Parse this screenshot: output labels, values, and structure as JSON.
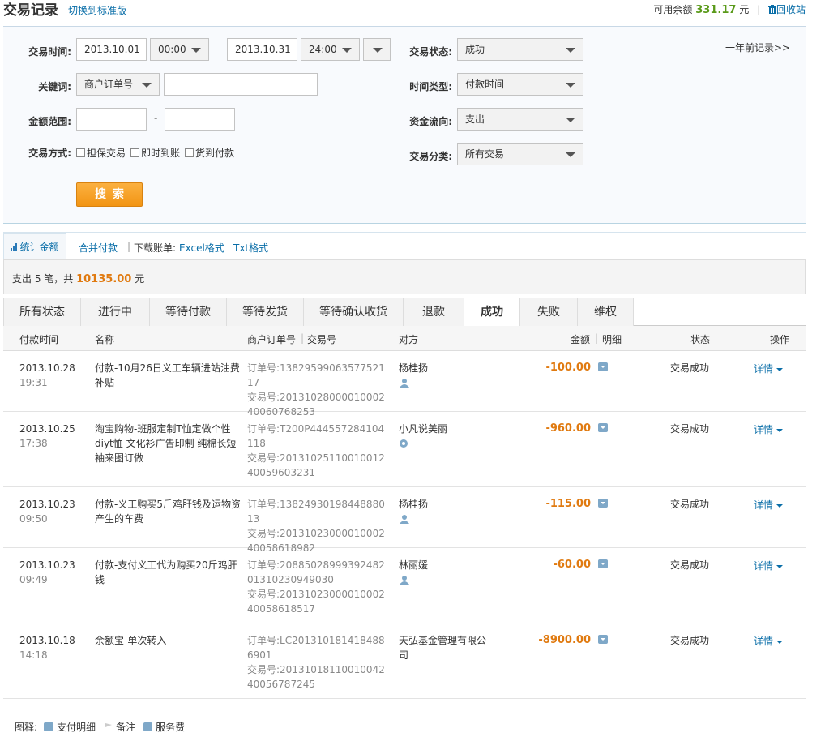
{
  "header": {
    "title": "交易记录",
    "switch_link": "切换到标准版",
    "balance_label": "可用余额",
    "balance_value": "331.17",
    "balance_unit": "元",
    "recycle_link": "回收站"
  },
  "filter": {
    "time_label": "交易时间:",
    "start_date": "2013.10.01",
    "start_time": "00:00",
    "range_dash": "-",
    "end_date": "2013.10.31",
    "end_time": "24:00",
    "keyword_label": "关键词:",
    "keyword_type": "商户订单号",
    "keyword_value": "",
    "amount_label": "金额范围:",
    "amount_min": "",
    "amount_max": "",
    "method_label": "交易方式:",
    "methods": [
      "担保交易",
      "即时到账",
      "货到付款"
    ],
    "status_label": "交易状态:",
    "status_value": "成功",
    "timetype_label": "时间类型:",
    "timetype_value": "付款时间",
    "flow_label": "资金流向:",
    "flow_value": "支出",
    "category_label": "交易分类:",
    "category_value": "所有交易",
    "search_button": "搜索",
    "history_link": "一年前记录>>"
  },
  "toolbar": {
    "stat": "统计金额",
    "merge": "合并付款",
    "separator": "|",
    "download_label": "下载账单:",
    "excel": "Excel格式",
    "txt": "Txt格式"
  },
  "summary": {
    "prefix": "支出 5 笔，共",
    "amount": "10135.00",
    "unit": "元"
  },
  "tabs": [
    "所有状态",
    "进行中",
    "等待付款",
    "等待发货",
    "等待确认收货",
    "退款",
    "成功",
    "失败",
    "维权"
  ],
  "active_tab": "成功",
  "columns": {
    "time": "付款时间",
    "name": "名称",
    "order": "商户订单号",
    "trade": "交易号",
    "party": "对方",
    "amount": "金额",
    "detail": "明细",
    "status": "状态",
    "op": "操作"
  },
  "rows": [
    {
      "date": "2013.10.28",
      "time": "19:31",
      "name": "付款-10月26日义工车辆进站油费补贴",
      "order": "订单号:1382959906357752117",
      "trade": "交易号:2013102800001000240060768253",
      "party": "杨桂扬",
      "amount": "-100.00",
      "status": "交易成功",
      "op": "详情"
    },
    {
      "date": "2013.10.25",
      "time": "17:38",
      "name": "淘宝购物-班服定制T恤定做个性diyt恤 文化衫广告印制 纯棉长短袖来图订做",
      "order": "订单号:T200P444557284104118",
      "trade": "交易号:2013102511001001240059603231",
      "party": "小凡说美丽",
      "amount": "-960.00",
      "status": "交易成功",
      "op": "详情"
    },
    {
      "date": "2013.10.23",
      "time": "09:50",
      "name": "付款-义工购买5斤鸡肝钱及运物资产生的车费",
      "order": "订单号:1382493019844888013",
      "trade": "交易号:2013102300001000240058618982",
      "party": "杨桂扬",
      "amount": "-115.00",
      "status": "交易成功",
      "op": "详情"
    },
    {
      "date": "2013.10.23",
      "time": "09:49",
      "name": "付款-支付义工代为购买20斤鸡肝钱",
      "order": "订单号:2088502899939248201310230949030",
      "trade": "交易号:2013102300001000240058618517",
      "party": "林丽媛",
      "amount": "-60.00",
      "status": "交易成功",
      "op": "详情"
    },
    {
      "date": "2013.10.18",
      "time": "14:18",
      "name": "余额宝-单次转入",
      "order": "订单号:LC2013101814184886901",
      "trade": "交易号:2013101811001004240056787245",
      "party": "天弘基金管理有限公司",
      "amount": "-8900.00",
      "status": "交易成功",
      "op": "详情"
    }
  ],
  "legend": {
    "label": "图释:",
    "detail": "支付明细",
    "note": "备注",
    "fee": "服务费"
  }
}
